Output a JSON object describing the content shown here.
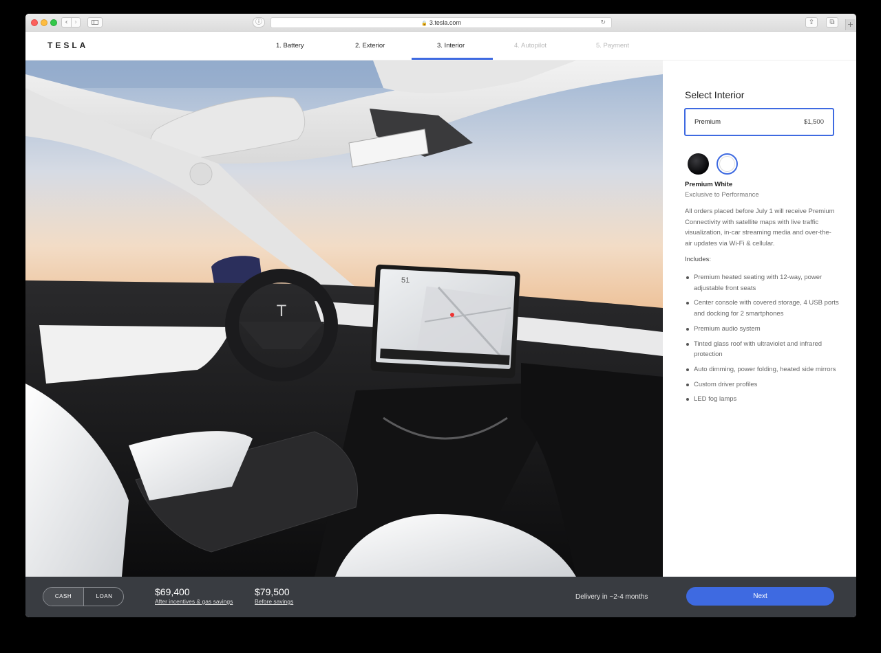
{
  "browser": {
    "url": "3.tesla.com",
    "back_icon": "‹",
    "forward_icon": "›",
    "info_icon": "ⓘ",
    "lock_icon": "🔒",
    "reload_icon": "↻",
    "share_icon": "⇪",
    "tabs_icon": "⧉",
    "new_tab_icon": "+"
  },
  "header": {
    "logo": "TESLA",
    "steps": [
      {
        "label": "1. Battery",
        "state": "done"
      },
      {
        "label": "2. Exterior",
        "state": "done"
      },
      {
        "label": "3. Interior",
        "state": "active"
      },
      {
        "label": "4. Autopilot",
        "state": "disabled"
      },
      {
        "label": "5. Payment",
        "state": "disabled"
      }
    ]
  },
  "hero": {
    "screen_speed": "51"
  },
  "panel": {
    "title": "Select Interior",
    "option": {
      "label": "Premium",
      "price": "$1,500"
    },
    "swatches": [
      {
        "name": "Premium Black",
        "color": "#0b0b0d",
        "selected": false
      },
      {
        "name": "Premium White",
        "color": "#ffffff",
        "selected": true
      }
    ],
    "color_name": "Premium White",
    "color_sub": "Exclusive to Performance",
    "promo": "All orders placed before July 1 will receive Premium Connectivity with satellite maps with live traffic visualization, in-car streaming media and over-the-air updates via Wi-Fi & cellular.",
    "includes_title": "Includes:",
    "includes": [
      "Premium heated seating with 12-way, power adjustable front seats",
      "Center console with covered storage, 4 USB ports and docking for 2 smartphones",
      "Premium audio system",
      "Tinted glass roof with ultraviolet and infrared protection",
      "Auto dimming, power folding, heated side mirrors",
      "Custom driver profiles",
      "LED fog lamps"
    ]
  },
  "footer": {
    "cash": "CASH",
    "loan": "LOAN",
    "price_after": "$69,400",
    "price_after_note": "After incentives & gas savings",
    "price_before": "$79,500",
    "price_before_note": "Before savings",
    "delivery": "Delivery in ~2-4 months",
    "next": "Next"
  },
  "colors": {
    "accent": "#3e6ae1",
    "footer_bg": "#393c41"
  }
}
